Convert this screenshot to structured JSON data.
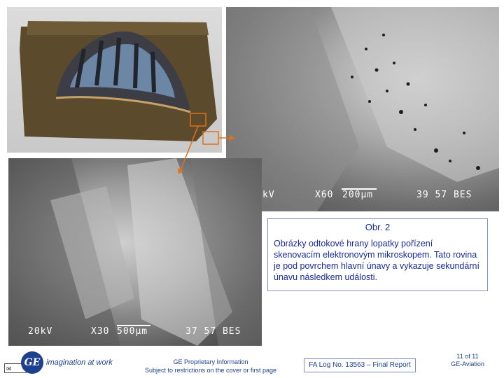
{
  "sem_top": {
    "voltage": "kV",
    "magnification": "X60",
    "scale": "200µm",
    "code": "39 57 BES"
  },
  "sem_bottom": {
    "voltage": "20kV",
    "magnification": "X30",
    "scale": "500µm",
    "code": "37 57 BES"
  },
  "caption": {
    "title": "Obr. 2",
    "text": "Obrázky odtokové hrany lopatky pořízení skenovacím elektronovým mikroskopem. Tato rovina je pod povrchem hlavní únavy a vykazuje sekundární únavu následkem události."
  },
  "footer": {
    "logo": "GE",
    "tagline": "imagination at work",
    "proprietary_line1": "GE Proprietary Information",
    "proprietary_line2": "Subject to restrictions on the cover or first page",
    "fa_log": "FA Log No. 13563 – Final Report",
    "page": "11 of  11",
    "division": "GE-Aviation"
  }
}
